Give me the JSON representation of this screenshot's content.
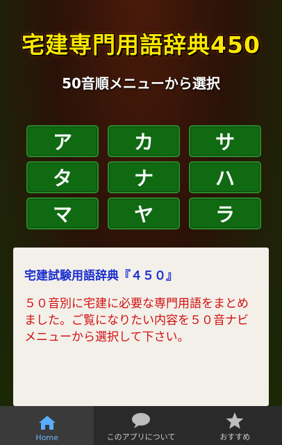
{
  "header": {
    "title": "宅建専門用語辞典450",
    "subtitle": "50音順メニューから選択"
  },
  "kana_menu": [
    "ア",
    "カ",
    "サ",
    "タ",
    "ナ",
    "ハ",
    "マ",
    "ヤ",
    "ラ"
  ],
  "info": {
    "heading": "宅建試験用語辞典『４５０』",
    "body": "５０音別に宅建に必要な専門用語をまとめました。ご覧になりたい内容を５０音ナビメニューから選択して下さい。"
  },
  "tabbar": {
    "tabs": [
      {
        "label": "Home",
        "icon": "home-icon"
      },
      {
        "label": "このアプリについて",
        "icon": "speech-bubble-icon"
      },
      {
        "label": "おすすめ",
        "icon": "star-icon"
      }
    ],
    "active_index": 0
  },
  "colors": {
    "title": "#ffe600",
    "kana_button": "#0f6a12",
    "info_heading": "#1b2fd0",
    "info_body": "#d21010",
    "tab_active": "#6fb6ff"
  }
}
